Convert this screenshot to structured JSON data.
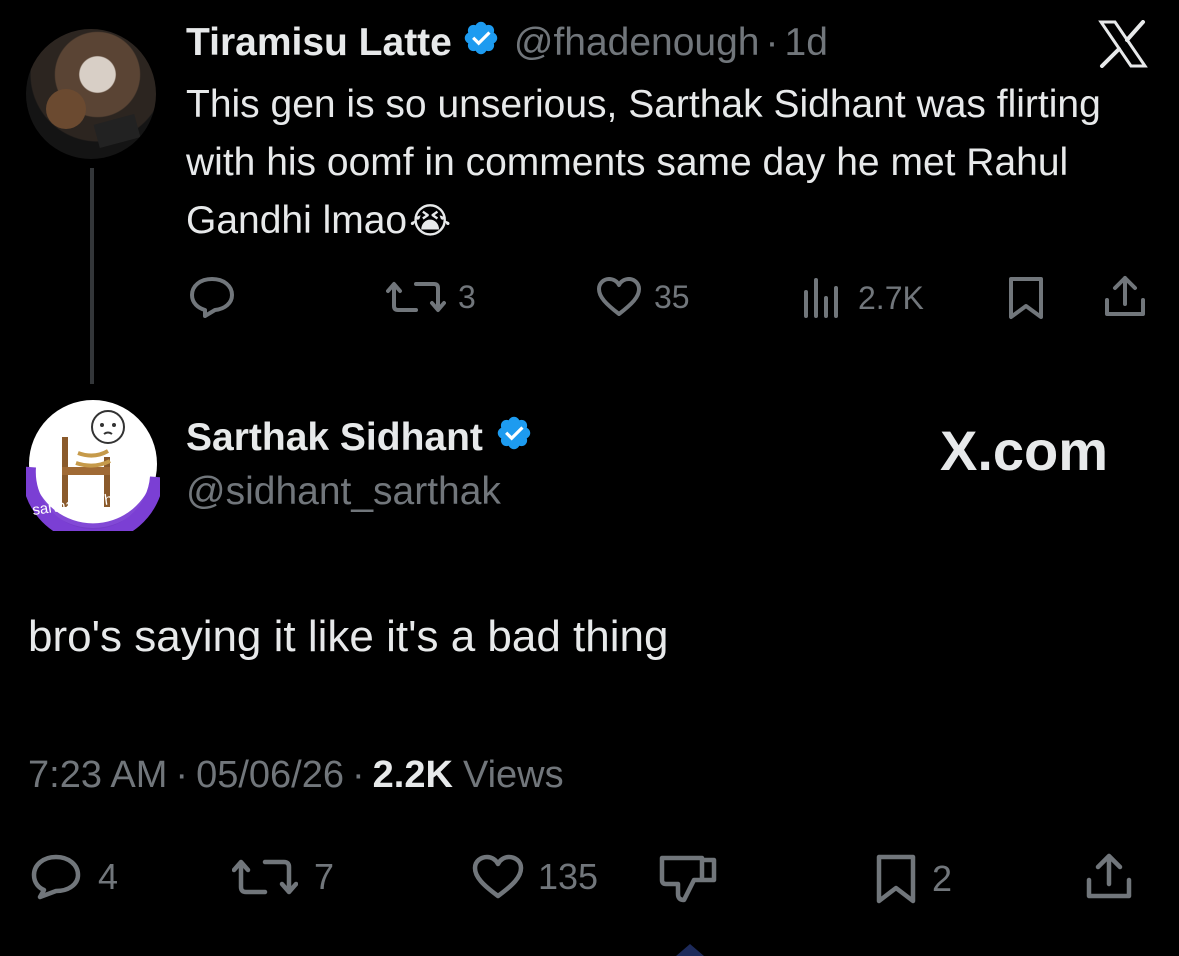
{
  "parent_tweet": {
    "author_name": "Tiramisu Latte",
    "handle": "@fhadenough",
    "dot": "·",
    "time_ago": "1d",
    "text": "This gen is so unserious, Sarthak Sidhant was flirting with his oomf in comments same day he met Rahul Gandhi lmao",
    "emoji": "😭",
    "stats": {
      "replies": "",
      "reposts": "3",
      "likes": "35",
      "views": "2.7K"
    }
  },
  "main_tweet": {
    "author_name": "Sarthak Sidhant",
    "handle": "@sidhant_sarthak",
    "avatar_text": "sarthak sidhant",
    "watermark": "X.com",
    "text": "bro's saying it like it's a bad thing",
    "time": "7:23 AM",
    "date": "05/06/26",
    "sep": "·",
    "views_count": "2.2K",
    "views_label": "Views",
    "stats": {
      "replies": "4",
      "reposts": "7",
      "likes": "135",
      "bookmarks": "2"
    }
  },
  "icons": {
    "x_logo": "x-logo-icon",
    "verified": "verified-badge-icon",
    "reply": "reply-icon",
    "repost": "repost-icon",
    "like": "heart-icon",
    "views": "views-icon",
    "bookmark": "bookmark-icon",
    "share": "share-icon",
    "dislike": "dislike-icon"
  },
  "colors": {
    "background": "#000000",
    "text": "#e7e9ea",
    "muted": "#71767b",
    "verified": "#1d9bf0",
    "avatar_ring": "#7b3fd4"
  }
}
